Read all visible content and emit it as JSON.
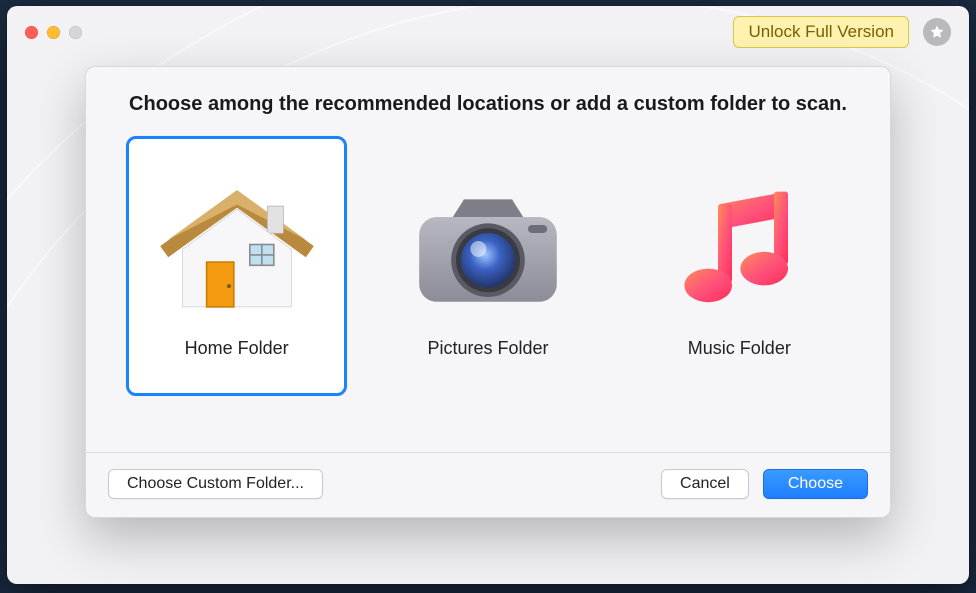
{
  "titlebar": {
    "unlock_label": "Unlock Full Version"
  },
  "sheet": {
    "heading": "Choose among the recommended locations or add a custom folder to scan."
  },
  "options": {
    "home": {
      "label": "Home Folder",
      "selected": true
    },
    "pictures": {
      "label": "Pictures Folder",
      "selected": false
    },
    "music": {
      "label": "Music Folder",
      "selected": false
    }
  },
  "footer": {
    "custom_label": "Choose Custom Folder...",
    "cancel_label": "Cancel",
    "choose_label": "Choose"
  },
  "colors": {
    "accent": "#1a84ff",
    "unlock_bg": "#fff2b0"
  }
}
